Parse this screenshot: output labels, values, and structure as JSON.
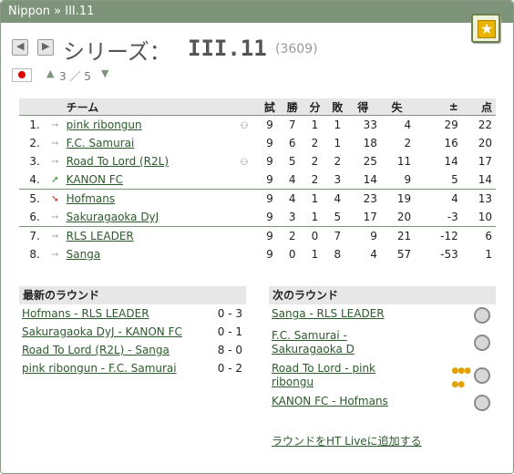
{
  "header": {
    "breadcrumb": "Nippon » III.11"
  },
  "series": {
    "label": "シリーズ：",
    "name": "III.11",
    "id_text": "(3609)",
    "level_text": "3 ／ 5"
  },
  "colors": {
    "titlebar": "#7d937a",
    "link": "#2c5a2c",
    "header_bg": "#e7e7e7"
  },
  "standings": {
    "headers": {
      "team": "チーム",
      "played": "試",
      "won": "勝",
      "draw": "分",
      "lost": "敗",
      "gf": "得",
      "ga": "失",
      "gd": "±",
      "pts": "点"
    },
    "rows": [
      {
        "pos": "1.",
        "trend": "same",
        "team": "pink ribongun",
        "sup": true,
        "played": "9",
        "won": "7",
        "draw": "1",
        "lost": "1",
        "gf": "33",
        "ga": "4",
        "gd": "29",
        "pts": "22"
      },
      {
        "pos": "2.",
        "trend": "same",
        "team": "F.C. Samurai",
        "sup": false,
        "played": "9",
        "won": "6",
        "draw": "2",
        "lost": "1",
        "gf": "18",
        "ga": "2",
        "gd": "16",
        "pts": "20"
      },
      {
        "pos": "3.",
        "trend": "same",
        "team": "Road To Lord (R2L)",
        "sup": true,
        "played": "9",
        "won": "5",
        "draw": "2",
        "lost": "2",
        "gf": "25",
        "ga": "11",
        "gd": "14",
        "pts": "17"
      },
      {
        "pos": "4.",
        "trend": "up",
        "team": "KANON FC",
        "sup": false,
        "played": "9",
        "won": "4",
        "draw": "2",
        "lost": "3",
        "gf": "14",
        "ga": "9",
        "gd": "5",
        "pts": "14"
      },
      {
        "pos": "5.",
        "trend": "down",
        "team": "Hofmans",
        "sup": false,
        "played": "9",
        "won": "4",
        "draw": "1",
        "lost": "4",
        "gf": "23",
        "ga": "19",
        "gd": "4",
        "pts": "13"
      },
      {
        "pos": "6.",
        "trend": "same",
        "team": "Sakuragaoka DyJ",
        "sup": false,
        "played": "9",
        "won": "3",
        "draw": "1",
        "lost": "5",
        "gf": "17",
        "ga": "20",
        "gd": "-3",
        "pts": "10"
      },
      {
        "pos": "7.",
        "trend": "same",
        "team": "RLS LEADER",
        "sup": false,
        "played": "9",
        "won": "2",
        "draw": "0",
        "lost": "7",
        "gf": "9",
        "ga": "21",
        "gd": "-12",
        "pts": "6"
      },
      {
        "pos": "8.",
        "trend": "same",
        "team": "Sanga",
        "sup": false,
        "played": "9",
        "won": "0",
        "draw": "1",
        "lost": "8",
        "gf": "4",
        "ga": "57",
        "gd": "-53",
        "pts": "1"
      }
    ]
  },
  "latest_round": {
    "title": "最新のラウンド",
    "matches": [
      {
        "match": "Hofmans - RLS LEADER",
        "score": "0 - 3"
      },
      {
        "match": "Sakuragaoka DyJ - KANON FC",
        "score": "0 - 1"
      },
      {
        "match": "Road To Lord (R2L) - Sanga",
        "score": "8 - 0"
      },
      {
        "match": "pink ribongun - F.C. Samurai",
        "score": "0 - 2"
      }
    ]
  },
  "next_round": {
    "title": "次のラウンド",
    "matches": [
      {
        "line1": "Sanga - RLS LEADER",
        "line2": ""
      },
      {
        "line1": "F.C. Samurai -",
        "line2": "Sakuragaoka D"
      },
      {
        "line1": "Road To Lord - pink",
        "line2": "ribongu"
      },
      {
        "line1": "KANON FC - Hofmans",
        "line2": ""
      }
    ],
    "add_link": "ラウンドをHT Liveに追加する"
  }
}
